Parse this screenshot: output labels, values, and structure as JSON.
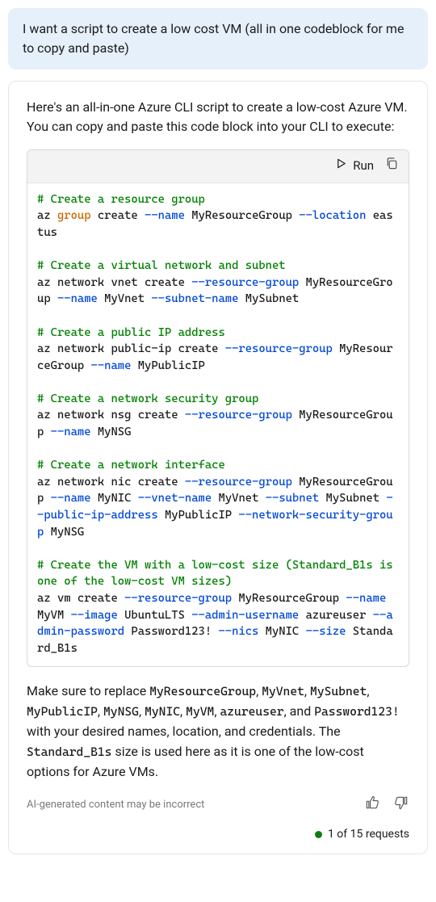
{
  "user_message": "I want a script to create a low cost VM (all in one codeblock for me to copy and paste)",
  "assistant_intro": "Here's an all-in-one Azure CLI script to create a low-cost Azure VM. You can copy and paste this code block into your CLI to execute:",
  "code_header": {
    "run_label": "Run"
  },
  "code_blocks": [
    {
      "comment": "# Create a resource group",
      "tokens": [
        {
          "t": "az ",
          "c": null
        },
        {
          "t": "group",
          "c": "kw"
        },
        {
          "t": " create ",
          "c": null
        },
        {
          "t": "--name",
          "c": "flag"
        },
        {
          "t": " MyResourceGroup ",
          "c": null
        },
        {
          "t": "--location",
          "c": "flag"
        },
        {
          "t": " eastus",
          "c": null
        }
      ]
    },
    {
      "comment": "# Create a virtual network and subnet",
      "tokens": [
        {
          "t": "az network vnet create ",
          "c": null
        },
        {
          "t": "--resource-group",
          "c": "flag"
        },
        {
          "t": " MyResourceGroup ",
          "c": null
        },
        {
          "t": "--name",
          "c": "flag"
        },
        {
          "t": " MyVnet ",
          "c": null
        },
        {
          "t": "--subnet-name",
          "c": "flag"
        },
        {
          "t": " MySubnet",
          "c": null
        }
      ]
    },
    {
      "comment": "# Create a public IP address",
      "tokens": [
        {
          "t": "az network public-ip create ",
          "c": null
        },
        {
          "t": "--resource-group",
          "c": "flag"
        },
        {
          "t": " MyResourceGroup ",
          "c": null
        },
        {
          "t": "--name",
          "c": "flag"
        },
        {
          "t": " MyPublicIP",
          "c": null
        }
      ]
    },
    {
      "comment": "# Create a network security group",
      "tokens": [
        {
          "t": "az network nsg create ",
          "c": null
        },
        {
          "t": "--resource-group",
          "c": "flag"
        },
        {
          "t": " MyResourceGroup ",
          "c": null
        },
        {
          "t": "--name",
          "c": "flag"
        },
        {
          "t": " MyNSG",
          "c": null
        }
      ]
    },
    {
      "comment": "# Create a network interface",
      "tokens": [
        {
          "t": "az network nic create ",
          "c": null
        },
        {
          "t": "--resource-group",
          "c": "flag"
        },
        {
          "t": " MyResourceGroup ",
          "c": null
        },
        {
          "t": "--name",
          "c": "flag"
        },
        {
          "t": " MyNIC ",
          "c": null
        },
        {
          "t": "--vnet-name",
          "c": "flag"
        },
        {
          "t": " MyVnet ",
          "c": null
        },
        {
          "t": "--subnet",
          "c": "flag"
        },
        {
          "t": " MySubnet ",
          "c": null
        },
        {
          "t": "--public-ip-address",
          "c": "flag"
        },
        {
          "t": " MyPublicIP ",
          "c": null
        },
        {
          "t": "--network-security-group",
          "c": "flag"
        },
        {
          "t": " MyNSG",
          "c": null
        }
      ]
    },
    {
      "comment": "# Create the VM with a low-cost size (Standard_B1s is one of the low-cost VM sizes)",
      "tokens": [
        {
          "t": "az vm create ",
          "c": null
        },
        {
          "t": "--resource-group",
          "c": "flag"
        },
        {
          "t": " MyResourceGroup ",
          "c": null
        },
        {
          "t": "--name",
          "c": "flag"
        },
        {
          "t": " MyVM ",
          "c": null
        },
        {
          "t": "--image",
          "c": "flag"
        },
        {
          "t": " UbuntuLTS ",
          "c": null
        },
        {
          "t": "--admin-username",
          "c": "flag"
        },
        {
          "t": " azureuser ",
          "c": null
        },
        {
          "t": "--admin-password",
          "c": "flag"
        },
        {
          "t": " Password123! ",
          "c": null
        },
        {
          "t": "--nics",
          "c": "flag"
        },
        {
          "t": " MyNIC ",
          "c": null
        },
        {
          "t": "--size",
          "c": "flag"
        },
        {
          "t": " Standard_B1s",
          "c": null
        }
      ]
    }
  ],
  "outro": {
    "prefix": "Make sure to replace ",
    "replacements": [
      "MyResourceGroup",
      "MyVnet",
      "MySubnet",
      "MyPublicIP",
      "MyNSG",
      "MyNIC",
      "MyVM",
      "azureuser",
      "Password123!"
    ],
    "middle": " with your desired names, location, and credentials. The ",
    "size_token": "Standard_B1s",
    "suffix": " size is used here as it is one of the low-cost options for Azure VMs."
  },
  "disclaimer": "AI-generated content may be incorrect",
  "quota": "1 of 15 requests"
}
